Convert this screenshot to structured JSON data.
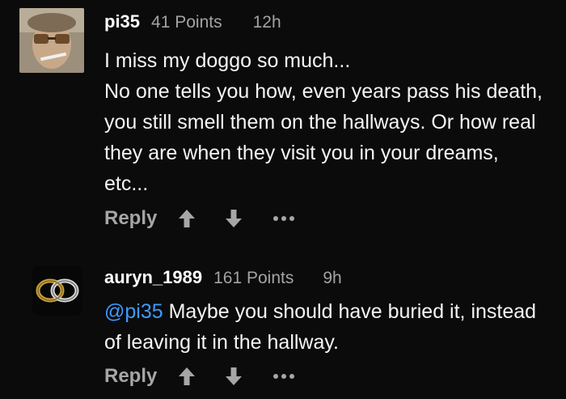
{
  "comments": [
    {
      "username": "pi35",
      "points": "41 Points",
      "time": "12h",
      "lines": [
        "I miss my doggo so much...",
        "No one tells you how, even years pass his death, you still smell them on the hallways. Or how real they are when they visit you in your dreams, etc..."
      ],
      "reply_label": "Reply"
    },
    {
      "username": "auryn_1989",
      "points": "161 Points",
      "time": "9h",
      "mention": "@pi35",
      "text": " Maybe you should have buried it, instead of leaving it in the hallway.",
      "reply_label": "Reply"
    }
  ],
  "colors": {
    "background": "#0b0b0b",
    "mention": "#3e9bff",
    "muted": "#a6a6a6"
  }
}
